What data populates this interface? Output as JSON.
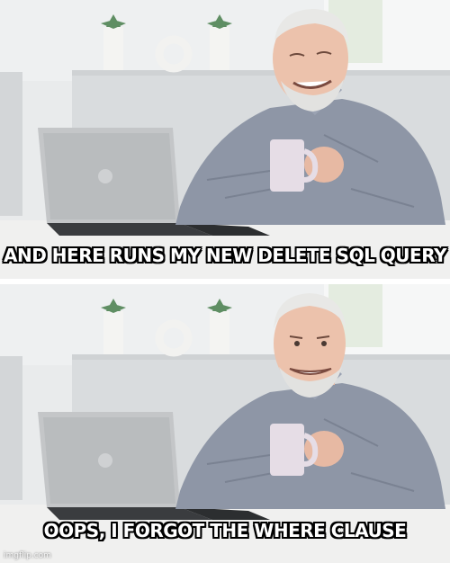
{
  "meme": {
    "template": "hide-the-pain-harold",
    "top_caption": "AND HERE RUNS MY NEW DELETE SQL QUERY",
    "bottom_caption": "OOPS, I FORGOT THE WHERE CLAUSE",
    "watermark": "imgflip.com"
  }
}
